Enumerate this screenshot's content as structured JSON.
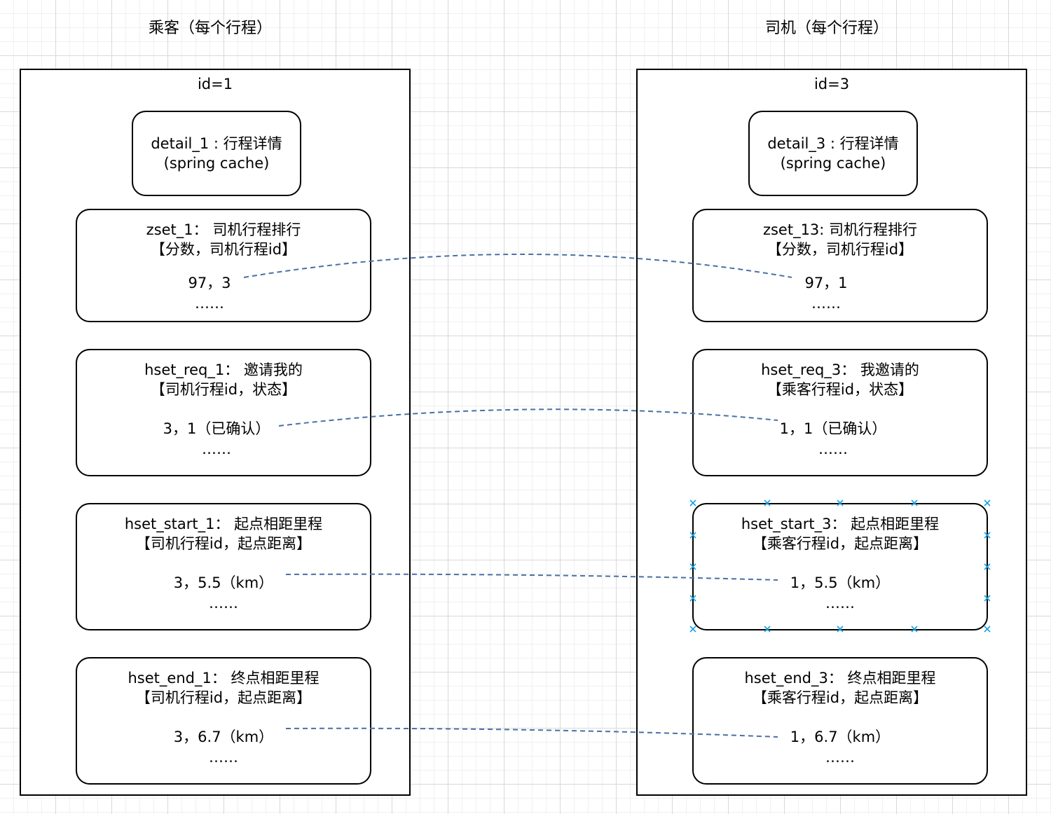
{
  "titles": {
    "passenger": "乘客（每个行程）",
    "driver": "司机（每个行程）"
  },
  "passenger": {
    "id_label": "id=1",
    "detail": {
      "line1": "detail_1 : 行程详情",
      "line2": "(spring cache)"
    },
    "zset": {
      "line1": "zset_1： 司机行程排行",
      "line2": "【分数，司机行程id】",
      "entry": "97，3",
      "more": "……"
    },
    "hset_req": {
      "line1": "hset_req_1： 邀请我的",
      "line2": "【司机行程id，状态】",
      "entry": "3，1（已确认）",
      "more": "……"
    },
    "hset_start": {
      "line1": "hset_start_1： 起点相距里程",
      "line2": "【司机行程id，起点距离】",
      "entry": "3，5.5（km）",
      "more": "……"
    },
    "hset_end": {
      "line1": "hset_end_1： 终点相距里程",
      "line2": "【司机行程id，起点距离】",
      "entry": "3，6.7（km）",
      "more": "……"
    }
  },
  "driver": {
    "id_label": "id=3",
    "detail": {
      "line1": "detail_3 : 行程详情",
      "line2": "(spring cache)"
    },
    "zset": {
      "line1": "zset_13: 司机行程排行",
      "line2": "【分数，司机行程id】",
      "entry": "97，1",
      "more": "……"
    },
    "hset_req": {
      "line1": "hset_req_3： 我邀请的",
      "line2": "【乘客行程id，状态】",
      "entry": "1，1（已确认）",
      "more": "……"
    },
    "hset_start": {
      "line1": "hset_start_3： 起点相距里程",
      "line2": "【乘客行程id，起点距离】",
      "entry": "1，5.5（km）",
      "more": "……"
    },
    "hset_end": {
      "line1": "hset_end_3： 终点相距里程",
      "line2": "【乘客行程id，起点距离】",
      "entry": "1，6.7（km）",
      "more": "……"
    }
  },
  "colors": {
    "connector": "#4a6fa5",
    "selection_marker": "#1ba1e2"
  }
}
